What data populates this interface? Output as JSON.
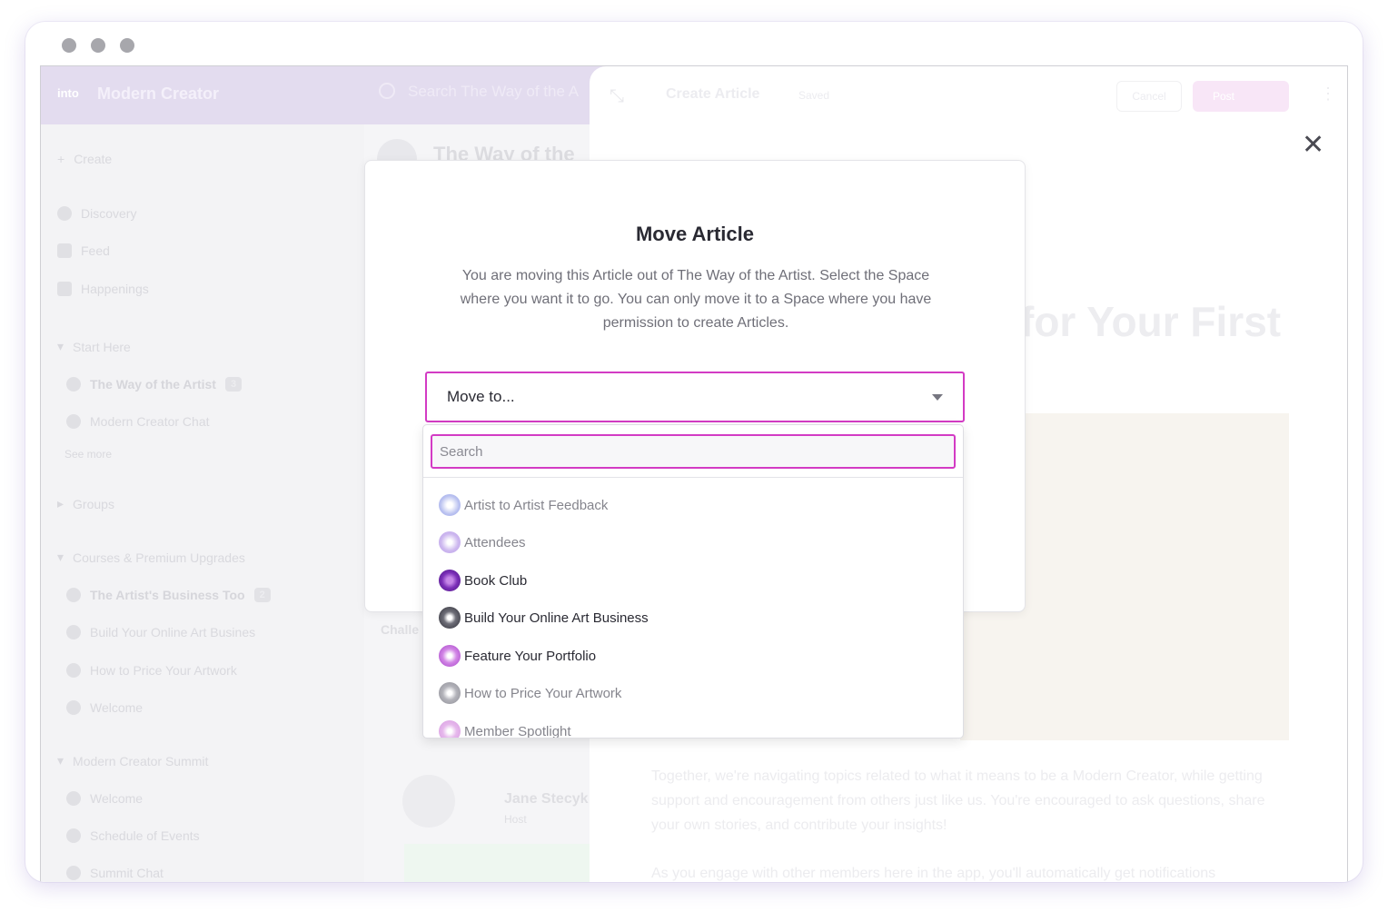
{
  "app": {
    "logo_text": "into",
    "brand": "Modern Creator",
    "search_placeholder": "Search The Way of the A"
  },
  "sidebar": {
    "create": "Create",
    "items": [
      {
        "label": "Discovery"
      },
      {
        "label": "Feed"
      },
      {
        "label": "Happenings"
      }
    ],
    "section_start": "Start Here",
    "start_items": [
      {
        "label": "The Way of the Artist",
        "count": "3"
      },
      {
        "label": "Modern Creator Chat"
      }
    ],
    "see_more": "See more",
    "section_groups": "Groups",
    "section_courses": "Courses & Premium Upgrades",
    "course_items": [
      {
        "label": "The Artist's Business Too",
        "count": "2"
      },
      {
        "label": "Build Your Online Art Busines"
      },
      {
        "label": "How to Price Your Artwork"
      },
      {
        "label": "Welcome"
      }
    ],
    "section_summit": "Modern Creator Summit",
    "summit_items": [
      {
        "label": "Welcome"
      },
      {
        "label": "Schedule of Events"
      },
      {
        "label": "Summit Chat"
      }
    ]
  },
  "feed": {
    "title": "The Way of the",
    "challenge": "Challe",
    "author_name": "Jane Stecyk",
    "author_role": "Host"
  },
  "panel": {
    "title": "Create Article",
    "saved": "Saved",
    "cancel": "Cancel",
    "post": "Post",
    "headline": "for Your First",
    "para1": "Together, we're navigating topics related to what it means to be a Modern Creator, while getting support and encouragement from others just like us. You're encouraged to ask questions, share your own stories, and contribute your insights!",
    "para2": "As you engage with other members here in the app, you'll automatically get notifications"
  },
  "modal": {
    "title": "Move Article",
    "description": "You are moving this Article out of The Way of the Artist. Select the Space where you want it to go. You can only move it to a Space where you have permission to create Articles.",
    "select_label": "Move to..."
  },
  "dropdown": {
    "search_placeholder": "Search",
    "options": [
      {
        "label": "Artist to Artist Feedback",
        "icon": "sparkle-blue-icon",
        "color": "#b9c1f0",
        "dim": true
      },
      {
        "label": "Attendees",
        "icon": "sparkle-lavender-icon",
        "color": "#cdb8ef",
        "dim": true
      },
      {
        "label": "Book Club",
        "icon": "sparkle-purple-icon",
        "color": "#7b2fb8",
        "dim": false
      },
      {
        "label": "Build Your Online Art Business",
        "icon": "sparkle-black-icon",
        "color": "#2e2e36",
        "dim": false
      },
      {
        "label": "Feature Your Portfolio",
        "icon": "sparkle-violet-icon",
        "color": "#a541c7",
        "dim": false
      },
      {
        "label": "How to Price Your Artwork",
        "icon": "sparkle-gray-icon",
        "color": "#8d8d95",
        "dim": true
      },
      {
        "label": "Member Spotlight",
        "icon": "sparkle-pink-icon",
        "color": "#d79be0",
        "dim": true
      }
    ]
  },
  "colors": {
    "accent": "#d33bc4",
    "title_text": "#2a2a33",
    "muted_text": "#6f6f78"
  }
}
